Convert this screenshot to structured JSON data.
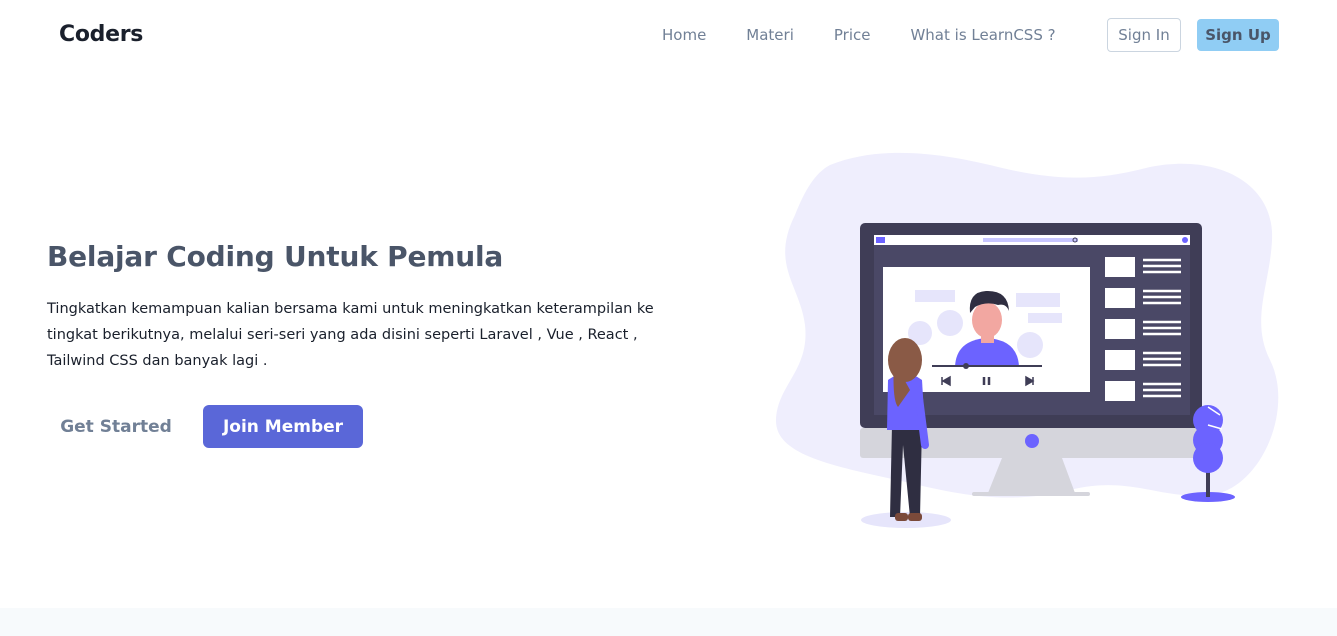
{
  "navbar": {
    "brand": "Coders",
    "links": [
      "Home",
      "Materi",
      "Price",
      "What is LearnCSS ?"
    ],
    "sign_in": "Sign In",
    "sign_up": "Sign Up"
  },
  "hero": {
    "title": "Belajar Coding Untuk Pemula",
    "description": "Tingkatkan kemampuan kalian bersama kami untuk meningkatkan keterampilan ke tingkat berikutnya, melalui seri-seri yang ada disini seperti Laravel , Vue , React , Tailwind CSS dan banyak lagi .",
    "get_started": "Get Started",
    "join_member": "Join Member"
  },
  "colors": {
    "accent": "#5a67d8",
    "signup_bg": "#90cdf4",
    "illustration_accent": "#6c63ff"
  }
}
